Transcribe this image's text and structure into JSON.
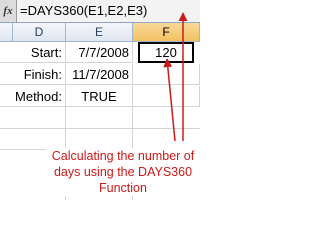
{
  "formula_bar": {
    "fx_label": "fx",
    "formula": "=DAYS360(E1,E2,E3)"
  },
  "columns": [
    "D",
    "E",
    "F"
  ],
  "selected_column": "F",
  "rows": [
    {
      "label": "Start:",
      "value": "7/7/2008",
      "result": "120"
    },
    {
      "label": "Finish:",
      "value": "11/7/2008",
      "result": ""
    },
    {
      "label": "Method:",
      "value": "TRUE",
      "result": ""
    }
  ],
  "caption": "Calculating the number of days using the DAYS360 Function",
  "colors": {
    "caption_red": "#cc1a1a",
    "arrow_red": "#cc1a1a",
    "selected_header": "#f1c15f"
  }
}
